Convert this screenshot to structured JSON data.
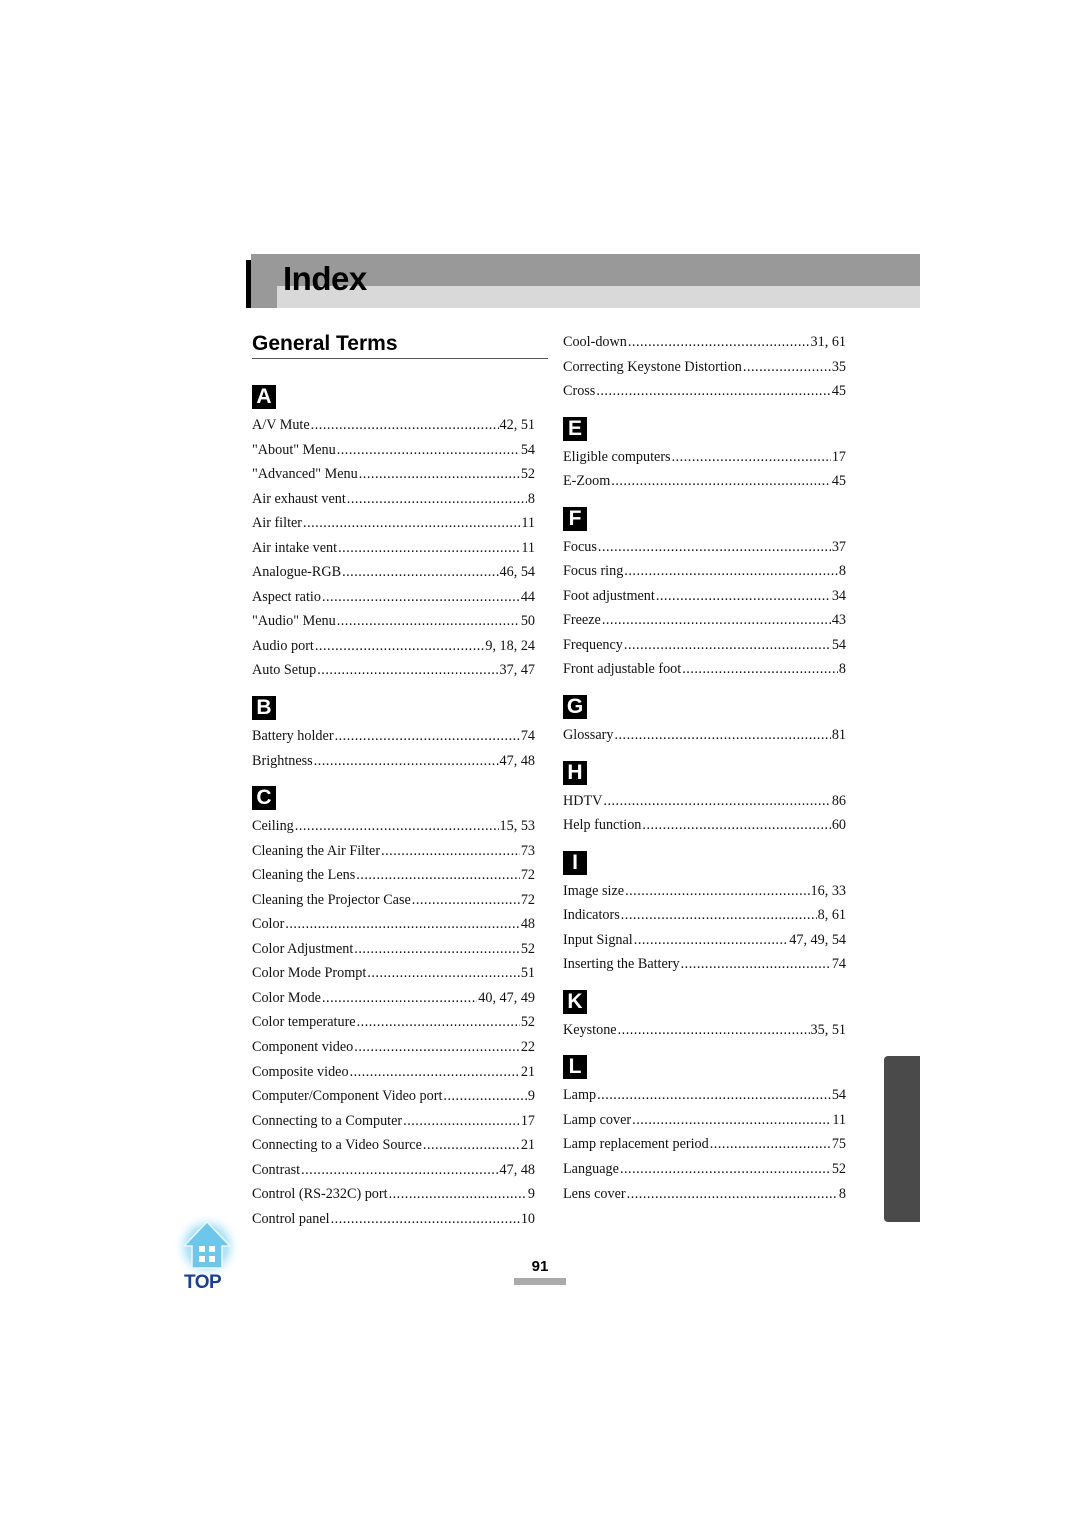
{
  "header": {
    "title": "Index"
  },
  "section": {
    "title": "General Terms"
  },
  "left_column": [
    {
      "letter": "A",
      "entries": [
        {
          "term": "A/V Mute",
          "pages": "42, 51"
        },
        {
          "term": "\"About\" Menu",
          "pages": "54"
        },
        {
          "term": "\"Advanced\" Menu",
          "pages": "52"
        },
        {
          "term": "Air exhaust vent",
          "pages": "8"
        },
        {
          "term": "Air filter",
          "pages": "11"
        },
        {
          "term": "Air intake vent",
          "pages": "11"
        },
        {
          "term": "Analogue-RGB",
          "pages": "46, 54"
        },
        {
          "term": "Aspect ratio",
          "pages": "44"
        },
        {
          "term": "\"Audio\" Menu",
          "pages": "50"
        },
        {
          "term": "Audio port",
          "pages": "9, 18, 24"
        },
        {
          "term": "Auto Setup",
          "pages": "37, 47"
        }
      ]
    },
    {
      "letter": "B",
      "entries": [
        {
          "term": "Battery holder",
          "pages": "74"
        },
        {
          "term": "Brightness",
          "pages": "47, 48"
        }
      ]
    },
    {
      "letter": "C",
      "entries": [
        {
          "term": "Ceiling",
          "pages": "15, 53"
        },
        {
          "term": "Cleaning the Air Filter",
          "pages": "73"
        },
        {
          "term": "Cleaning the Lens",
          "pages": "72"
        },
        {
          "term": "Cleaning the Projector Case",
          "pages": "72"
        },
        {
          "term": "Color",
          "pages": "48"
        },
        {
          "term": "Color Adjustment",
          "pages": "52"
        },
        {
          "term": "Color Mode Prompt",
          "pages": "51"
        },
        {
          "term": "Color Mode",
          "pages": "40, 47, 49"
        },
        {
          "term": "Color temperature",
          "pages": "52"
        },
        {
          "term": "Component video",
          "pages": "22"
        },
        {
          "term": "Composite video",
          "pages": "21"
        },
        {
          "term": "Computer/Component Video port",
          "pages": "9"
        },
        {
          "term": "Connecting to a Computer",
          "pages": "17"
        },
        {
          "term": "Connecting to a Video Source",
          "pages": "21"
        },
        {
          "term": "Contrast",
          "pages": "47, 48"
        },
        {
          "term": "Control (RS-232C) port",
          "pages": "9"
        },
        {
          "term": "Control panel",
          "pages": "10"
        }
      ]
    }
  ],
  "right_column": [
    {
      "letter": "",
      "entries": [
        {
          "term": "Cool-down",
          "pages": "31, 61"
        },
        {
          "term": "Correcting Keystone Distortion",
          "pages": "35"
        },
        {
          "term": "Cross",
          "pages": "45"
        }
      ]
    },
    {
      "letter": "E",
      "entries": [
        {
          "term": "Eligible computers",
          "pages": "17"
        },
        {
          "term": "E-Zoom",
          "pages": "45"
        }
      ]
    },
    {
      "letter": "F",
      "entries": [
        {
          "term": "Focus",
          "pages": "37"
        },
        {
          "term": "Focus ring",
          "pages": "8"
        },
        {
          "term": "Foot adjustment",
          "pages": "34"
        },
        {
          "term": "Freeze",
          "pages": "43"
        },
        {
          "term": "Frequency",
          "pages": "54"
        },
        {
          "term": "Front adjustable foot",
          "pages": "8"
        }
      ]
    },
    {
      "letter": "G",
      "entries": [
        {
          "term": "Glossary",
          "pages": "81"
        }
      ]
    },
    {
      "letter": "H",
      "entries": [
        {
          "term": "HDTV",
          "pages": "86"
        },
        {
          "term": "Help function",
          "pages": "60"
        }
      ]
    },
    {
      "letter": "I",
      "entries": [
        {
          "term": "Image size",
          "pages": "16, 33"
        },
        {
          "term": "Indicators",
          "pages": "8, 61"
        },
        {
          "term": "Input Signal",
          "pages": "47, 49, 54"
        },
        {
          "term": "Inserting the Battery",
          "pages": "74"
        }
      ]
    },
    {
      "letter": "K",
      "entries": [
        {
          "term": "Keystone",
          "pages": "35, 51"
        }
      ]
    },
    {
      "letter": "L",
      "entries": [
        {
          "term": "Lamp",
          "pages": "54"
        },
        {
          "term": "Lamp cover",
          "pages": "11"
        },
        {
          "term": "Lamp replacement period",
          "pages": "75"
        },
        {
          "term": "Language",
          "pages": "52"
        },
        {
          "term": "Lens cover",
          "pages": "8"
        }
      ]
    }
  ],
  "footer": {
    "top_label": "TOP",
    "page_number": "91"
  }
}
